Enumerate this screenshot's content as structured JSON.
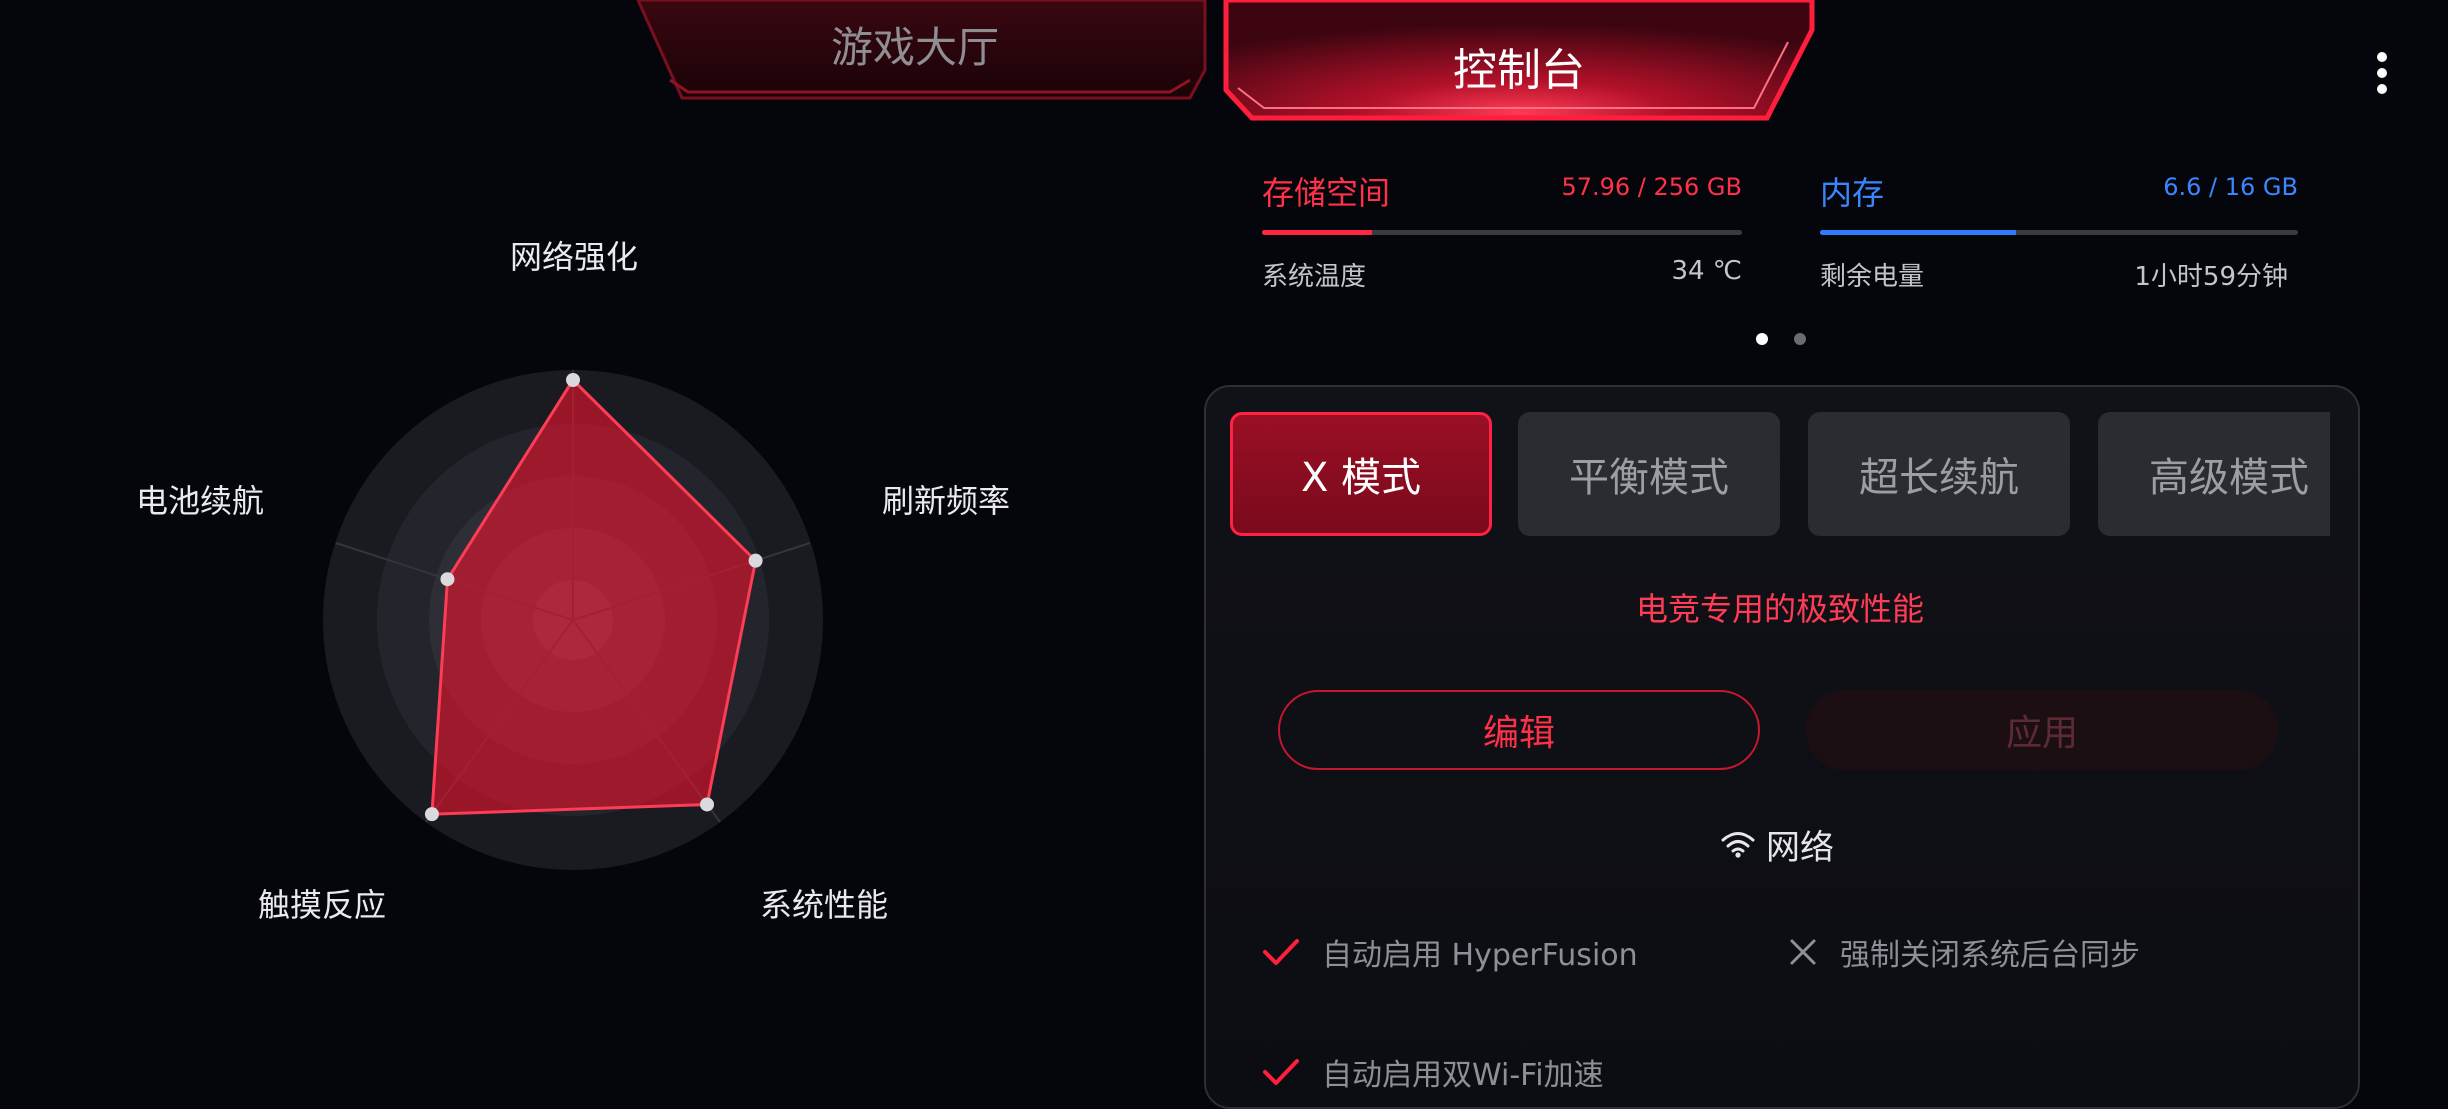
{
  "tabs": {
    "lobby": "游戏大厅",
    "console": "控制台",
    "active": "console"
  },
  "radar": {
    "labels": {
      "network": "网络强化",
      "refresh": "刷新频率",
      "system": "系统性能",
      "touch": "触摸反应",
      "battery": "电池续航"
    },
    "levels": {
      "network": 1.0,
      "refresh": 0.8,
      "system": 0.95,
      "touch": 1.0,
      "battery": 0.55
    }
  },
  "stats": {
    "storage": {
      "label": "存储空间",
      "value": "57.96 / 256 GB",
      "fraction": 0.23,
      "color": "#ff2741"
    },
    "memory": {
      "label": "内存",
      "value": "6.6 / 16 GB",
      "fraction": 0.41,
      "color": "#2d7bff"
    },
    "temperature": {
      "label": "系统温度",
      "value": "34 ℃"
    },
    "battery_left": {
      "label": "剩余电量",
      "value": "1小时59分钟"
    },
    "pager": {
      "pages": 2,
      "current": 1
    }
  },
  "modes": {
    "items": [
      "X 模式",
      "平衡模式",
      "超长续航",
      "高级模式"
    ],
    "active_index": 0,
    "description": "电竞专用的极致性能",
    "edit_label": "编辑",
    "apply_label": "应用"
  },
  "network": {
    "title": "网络",
    "options": [
      {
        "label": "自动启用 HyperFusion",
        "enabled": true
      },
      {
        "label": "强制关闭系统后台同步",
        "enabled": false
      },
      {
        "label": "自动启用双Wi-Fi加速",
        "enabled": true
      }
    ]
  },
  "colors": {
    "accent": "#ff1f3d",
    "memory_blue": "#2d7bff",
    "background": "#04060c"
  }
}
